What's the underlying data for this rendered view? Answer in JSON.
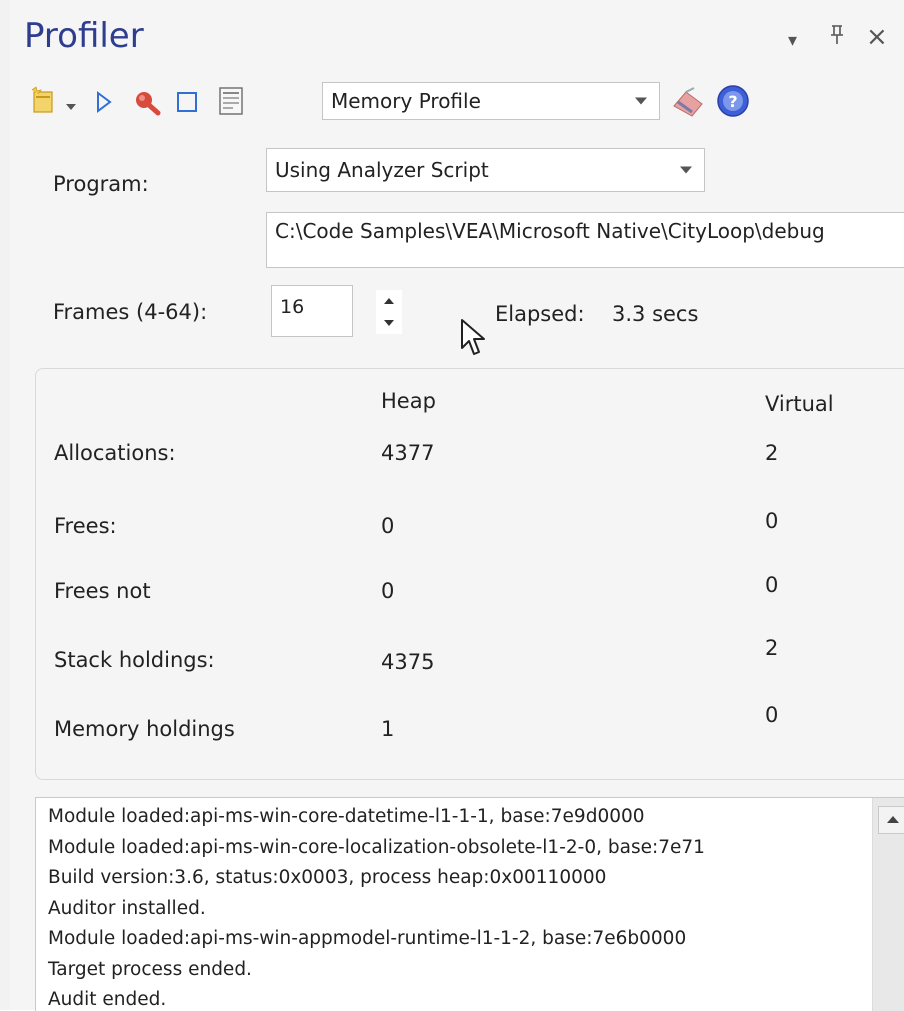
{
  "window": {
    "title": "Profiler",
    "controls": {
      "menu": "▾",
      "pin": "ꟷ",
      "close": "×"
    }
  },
  "toolbar": {
    "profile_type": "Memory Profile",
    "icons": [
      "new-icon",
      "dropdown-icon",
      "play-icon",
      "search-icon",
      "stop-icon",
      "report-icon",
      "eraser-icon",
      "help-icon"
    ]
  },
  "form": {
    "program_label": "Program:",
    "program_value": "Using Analyzer Script",
    "path_value": "C:\\Code Samples\\VEA\\Microsoft Native\\CityLoop\\debug",
    "frames_label": "Frames (4-64):",
    "frames_value": "16",
    "elapsed_label": "Elapsed:",
    "elapsed_value": "3.3 secs"
  },
  "stats": {
    "columns": [
      "Heap",
      "Virtual"
    ],
    "rows": [
      {
        "label": "Allocations:",
        "heap": "4377",
        "virtual": "2"
      },
      {
        "label": "Frees:",
        "heap": "0",
        "virtual": "0"
      },
      {
        "label": "Frees not",
        "heap": "0",
        "virtual": "0"
      },
      {
        "label": "Stack holdings:",
        "heap": "4375",
        "virtual": "2"
      },
      {
        "label": "Memory holdings",
        "heap": "1",
        "virtual": "0"
      }
    ]
  },
  "log": [
    "Module loaded:api-ms-win-core-datetime-l1-1-1, base:7e9d0000",
    "Module loaded:api-ms-win-core-localization-obsolete-l1-2-0, base:7e71",
    "Build version:3.6, status:0x0003, process heap:0x00110000",
    "Auditor installed.",
    "Module loaded:api-ms-win-appmodel-runtime-l1-1-2, base:7e6b0000",
    "Target process ended.",
    "Audit ended."
  ],
  "colors": {
    "title": "#2f3d8f",
    "accent_blue": "#2f6fd6",
    "search_red": "#d84a3c",
    "help_blue": "#3d5fd8"
  }
}
